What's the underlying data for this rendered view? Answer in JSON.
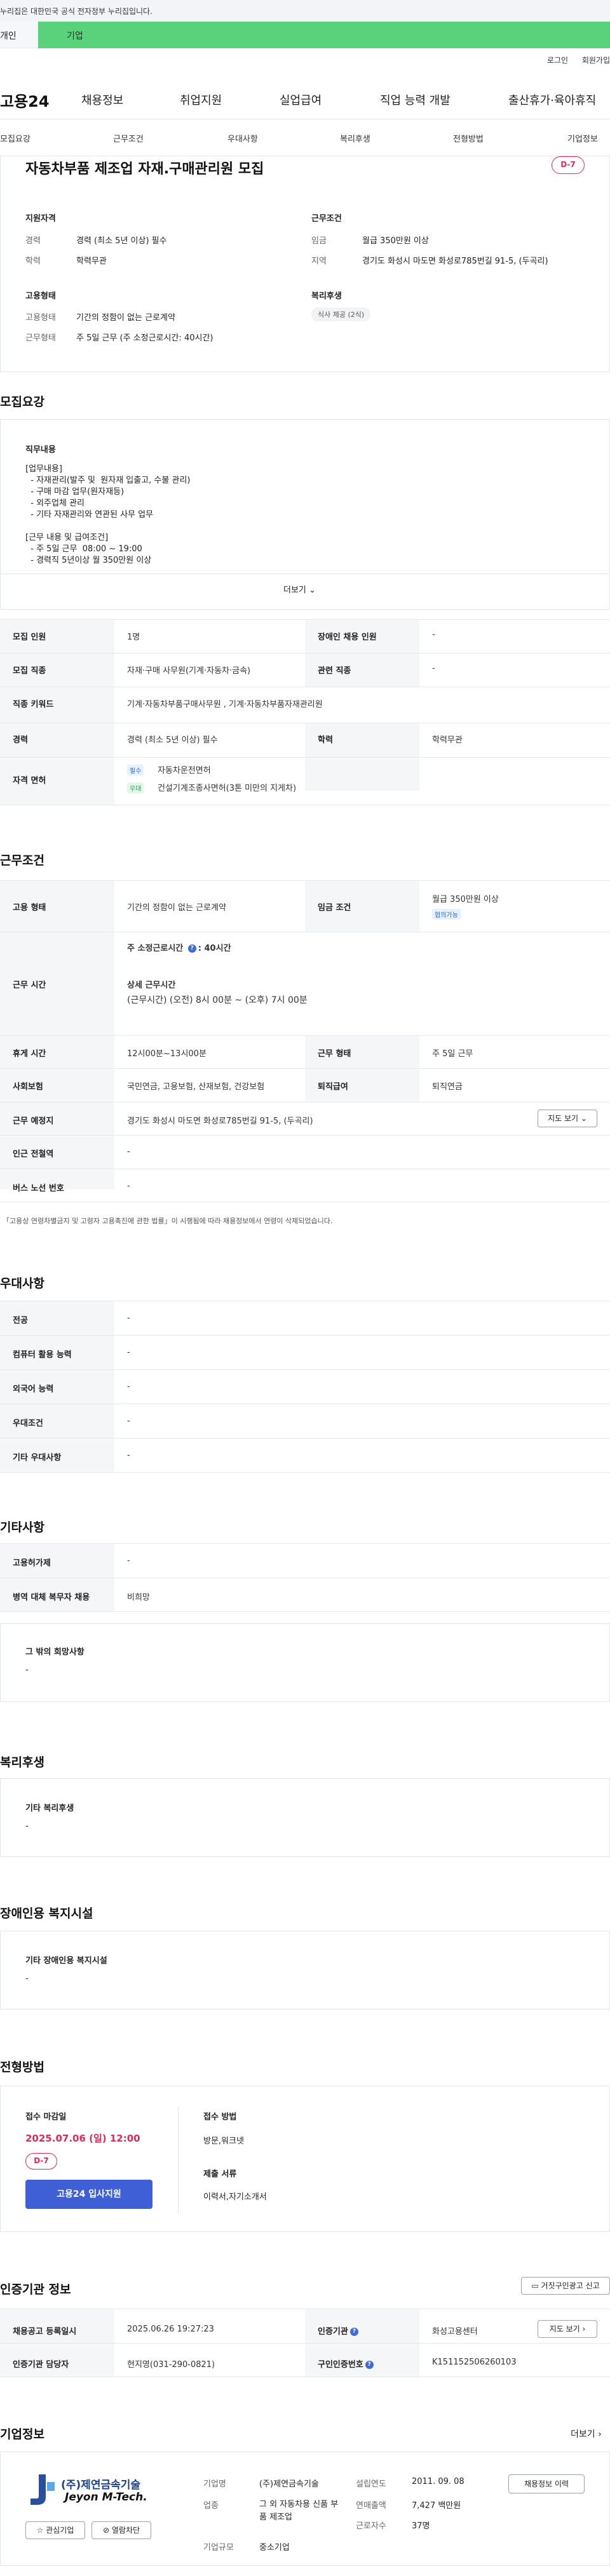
{
  "gov_bar": {
    "text": "누리집은 대한민국 공식 전자정부 누리집입니다."
  },
  "user_type": {
    "personal": "개인",
    "company": "기업"
  },
  "util": {
    "login": "로그인",
    "join": "회원가입"
  },
  "gnb": {
    "logo": "고용24",
    "items": [
      "채용정보",
      "취업지원",
      "실업급여",
      "직업 능력 개발",
      "출산휴가·육아휴직"
    ]
  },
  "subnav": {
    "items": [
      "모집요강",
      "근무조건",
      "우대사항",
      "복리후생",
      "전형방법",
      "기업정보"
    ]
  },
  "summary": {
    "title": "자동차부품 제조업 자재.구매관리원 모집",
    "dday": "D-7",
    "qualification": {
      "heading": "지원자격",
      "career_label": "경력",
      "career_value": "경력 (최소 5년 이상) 필수",
      "edu_label": "학력",
      "edu_value": "학력무관"
    },
    "conditions": {
      "heading": "근무조건",
      "wage_label": "임금",
      "wage_value": "월급 350만원 이상",
      "region_label": "지역",
      "region_value": "경기도 화성시 마도면 화성로785번길 91-5, (두곡리)"
    },
    "employment": {
      "heading": "고용형태",
      "type_label": "고용형태",
      "type_value": "기간의 정함이 없는 근로계약",
      "work_label": "근무형태",
      "work_value": "주 5일 근무 (주 소정근로시간: 40시간)"
    },
    "welfare": {
      "heading": "복리후생",
      "chip": "식사 제공 (2식)"
    }
  },
  "recruit": {
    "section_title": "모집요강",
    "job_content_heading": "직무내용",
    "job_content_text": "[업무내용]\n  - 자재관리(발주 및  원자재 입출고, 수불 관리)\n  - 구매 마감 업무(원자재등)\n  - 외주업체 관리\n  - 기타 자재관리와 연관된 사무 업무\n\n[근무 내용 및 급여조건]\n  - 주 5일 근무  08:00 ~ 19:00\n  - 경력직 5년이상 월 350만원 이상",
    "more_label": "더보기",
    "rows": {
      "headcount_label": "모집 인원",
      "headcount_value": "1명",
      "disabled_label": "장애인 채용 인원",
      "disabled_value": "-",
      "job_label": "모집 직종",
      "job_value": "자재·구매 사무원(기계·자동차·금속)",
      "related_label": "관련 직종",
      "related_value": "-",
      "keyword_label": "직종 키워드",
      "keyword_value": "기계·자동차부품구매사무원 , 기계·자동차부품자재관리원",
      "career_label": "경력",
      "career_value": "경력 (최소 5년 이상) 필수",
      "edu_label": "학력",
      "edu_value": "학력무관",
      "license_label": "자격 면허",
      "license_tag1": "필수",
      "license_item1": "자동차운전면허",
      "license_tag2": "우대",
      "license_item2": "건설기계조종사면허(3톤 미만의 지게차)"
    }
  },
  "work": {
    "section_title": "근무조건",
    "emp_type_label": "고용 형태",
    "emp_type_value": "기간의 정함이 없는 근로계약",
    "wage_label": "임금 조건",
    "wage_value": "월급 350만원 이상",
    "wage_tag": "협의가능",
    "hours_label": "근무 시간",
    "weekly_hours_label": "주 소정근로시간",
    "weekly_hours_value": "40시간",
    "detail_hours_label": "상세 근무시간",
    "detail_hours_value": "(근무시간) (오전) 8시 00분 ~ (오후) 7시 00분",
    "break_label": "휴게 시간",
    "break_value": "12시00분~13시00분",
    "shift_label": "근무 형태",
    "shift_value": "주 5일 근무",
    "insurance_label": "사회보험",
    "insurance_value": "국민연금, 고용보험, 산재보험, 건강보험",
    "severance_label": "퇴직급여",
    "severance_value": "퇴직연금",
    "location_label": "근무 예정지",
    "location_value": "경기도 화성시 마도면 화성로785번길 91-5, (두곡리)",
    "map_button": "지도 보기",
    "subway_label": "인근 전철역",
    "subway_value": "-",
    "bus_label": "버스 노선 번호",
    "bus_value": "-",
    "note": "「고용상 연령차별금지 및 고령자 고용촉진에 관한 법률」이 시행됨에 따라 채용정보에서 연령이 삭제되었습니다."
  },
  "preference": {
    "section_title": "우대사항",
    "major_label": "전공",
    "major_value": "-",
    "pc_label": "컴퓨터 활용 능력",
    "pc_value": "-",
    "lang_label": "외국어 능력",
    "lang_value": "-",
    "cond_label": "우대조건",
    "cond_value": "-",
    "etc_label": "기타 우대사항",
    "etc_value": "-"
  },
  "etc": {
    "section_title": "기타사항",
    "permit_label": "고용허가제",
    "permit_value": "-",
    "military_label": "병역 대체 복무자 채용",
    "military_value": "비희망",
    "other_heading": "그 밖의 희망사항",
    "other_value": "-"
  },
  "welfare": {
    "section_title": "복리후생",
    "heading": "기타 복리후생",
    "value": "-"
  },
  "disabled_fac": {
    "section_title": "장애인용 복지시설",
    "heading": "기타 장애인용 복지시설",
    "value": "-"
  },
  "selection": {
    "section_title": "전형방법",
    "deadline_label": "접수 마감일",
    "deadline_value": "2025.07.06 (일) 12:00",
    "dday": "D-7",
    "apply_button": "고용24 입사지원",
    "method_label": "접수 방법",
    "method_value": "방문,워크넷",
    "docs_label": "제출 서류",
    "docs_value": "이력서,자기소개서"
  },
  "agency": {
    "section_title": "인증기관 정보",
    "report_button": "거짓구인광고 신고",
    "reg_label": "채용공고 등록일시",
    "reg_value": "2025.06.26 19:27:23",
    "org_label": "인증기관",
    "org_value": "화성고용센터",
    "map_button": "지도 보기",
    "manager_label": "인증기관 담당자",
    "manager_value": "현지영(031-290-0821)",
    "id_label": "구인인증번호",
    "id_value": "K151152506260103"
  },
  "company": {
    "section_title": "기업정보",
    "more": "더보기",
    "logo_kor": "(주)제연금속기술",
    "logo_eng": "Jeyon M-Tech.",
    "interest_button": "관심기업",
    "block_button": "열람차단",
    "name_label": "기업명",
    "name_value": "(주)제연금속기술",
    "industry_label": "업종",
    "industry_value": "그 외 자동차용 신품 부품 제조업",
    "size_label": "기업규모",
    "size_value": "중소기업",
    "founded_label": "설립연도",
    "founded_value": "2011. 09. 08",
    "sales_label": "연매출액",
    "sales_value": "7,427 백만원",
    "employees_label": "근로자수",
    "employees_value": "37명",
    "history_button": "채용정보 이력"
  },
  "colors": {
    "brand_green": "#5ad17b",
    "dday_red": "#e5285a",
    "apply_blue": "#3f5fd6"
  }
}
